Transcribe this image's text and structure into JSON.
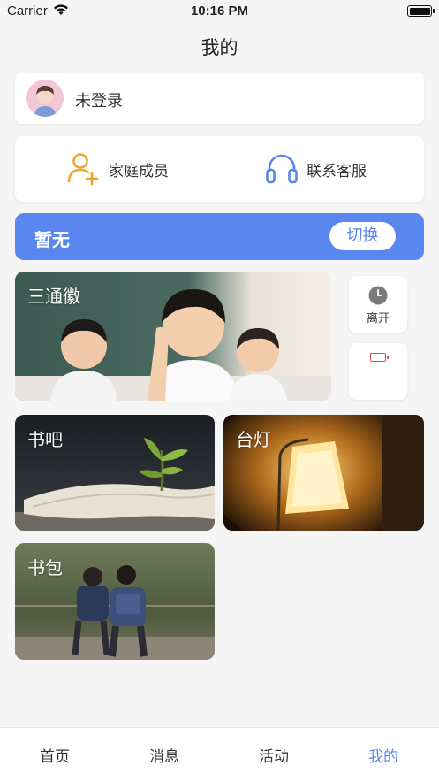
{
  "status_bar": {
    "carrier": "Carrier",
    "time": "10:16 PM"
  },
  "nav": {
    "title": "我的"
  },
  "user": {
    "name": "未登录"
  },
  "quick_actions": [
    {
      "label": "家庭成员",
      "icon": "add-user-icon"
    },
    {
      "label": "联系客服",
      "icon": "headset-icon"
    }
  ],
  "group": {
    "name": "暂无",
    "switch_label": "切换"
  },
  "tiles": {
    "santong": {
      "title": "三通徽"
    },
    "shuba": {
      "title": "书吧"
    },
    "taideng": {
      "title": "台灯"
    },
    "shubao": {
      "title": "书包"
    }
  },
  "status_cards": {
    "leave_label": "离开"
  },
  "tab_bar": {
    "items": [
      "首页",
      "消息",
      "活动",
      "我的"
    ],
    "active_index": 3
  },
  "colors": {
    "accent": "#5a86f0",
    "icon_orange": "#f0a531",
    "battery_low": "#e24b4b"
  }
}
